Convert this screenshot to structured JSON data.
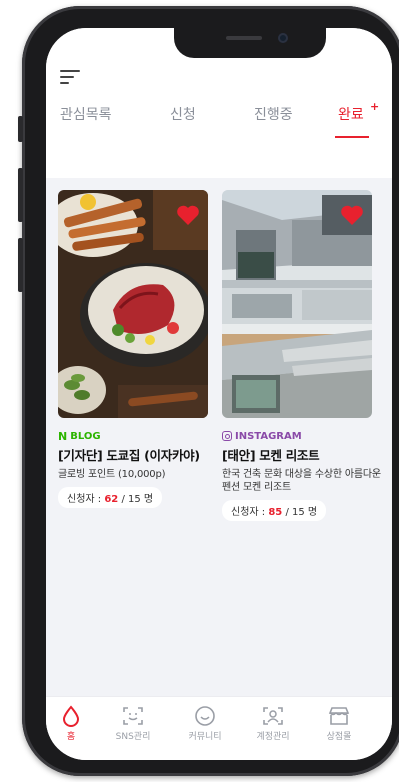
{
  "tabs": [
    {
      "label": "관심목록"
    },
    {
      "label": "신청"
    },
    {
      "label": "진행중"
    },
    {
      "label": "완료",
      "badge": "+"
    }
  ],
  "active_tab": "완료",
  "accent_color": "#e8212e",
  "cards": [
    {
      "source": "BLOG",
      "source_icon": "naver-n-icon",
      "title": "[기자단] 도쿄집 (이자카야)",
      "description": "글로빙 포인트 (10,000p)",
      "applicants_label": "신청자 :",
      "applicants_count": "62",
      "capacity": "/ 15 명",
      "favorited": true
    },
    {
      "source": "INSTAGRAM",
      "source_icon": "instagram-icon",
      "title": "[태안] 모켄 리조트",
      "description": "한국 건축 문화 대상을 수상한 아름다운 펜션 모켄 리조트",
      "applicants_label": "신청자 :",
      "applicants_count": "85",
      "capacity": "/ 15 명",
      "favorited": true
    }
  ],
  "bottom_nav": [
    {
      "label": "홈",
      "icon": "home-drop-icon",
      "active": true
    },
    {
      "label": "SNS관리",
      "icon": "face-scan-icon"
    },
    {
      "label": "커뮤니티",
      "icon": "smile-icon"
    },
    {
      "label": "계정관리",
      "icon": "account-icon"
    },
    {
      "label": "상점몰",
      "icon": "shop-icon"
    }
  ]
}
